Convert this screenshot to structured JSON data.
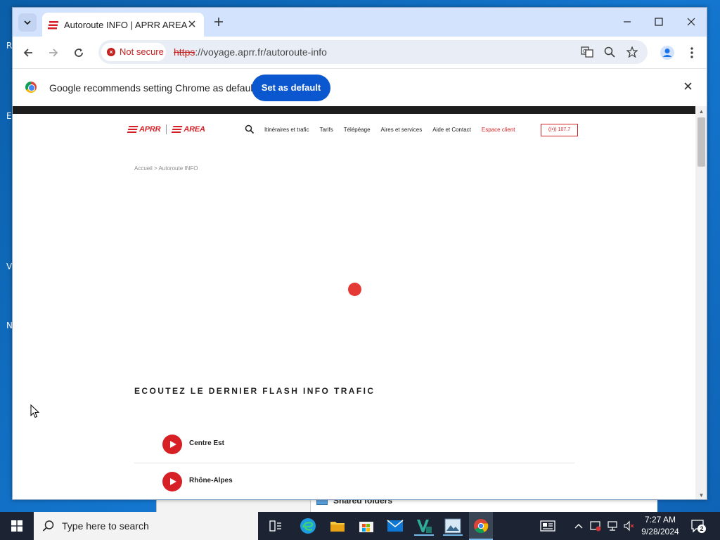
{
  "desktop": {
    "edge_letters": [
      "R",
      "E",
      "V",
      "N"
    ],
    "background_window_item": "Shared folders"
  },
  "browser": {
    "tab": {
      "title": "Autoroute INFO | APRR AREA"
    },
    "omnibox": {
      "security_label": "Not secure",
      "url_scheme": "https",
      "url_rest": "://voyage.aprr.fr/autoroute-info"
    },
    "infobar": {
      "message": "Google recommends setting Chrome as default",
      "button_label": "Set as default"
    }
  },
  "site": {
    "logo_left": "APRR",
    "logo_right": "AREA",
    "nav": [
      "Itinéraires et trafic",
      "Tarifs",
      "Télépéage",
      "Aires et services",
      "Aide et Contact"
    ],
    "account_link": "Espace client",
    "radio_label": "107.7",
    "breadcrumb": "Accueil  >  Autoroute INFO",
    "flash_title": "ECOUTEZ LE DERNIER FLASH INFO TRAFIC",
    "regions": [
      "Centre Est",
      "Rhône-Alpes"
    ],
    "accent_color": "#d71f26"
  },
  "taskbar": {
    "search_placeholder": "Type here to search",
    "time": "7:27 AM",
    "date": "9/28/2024",
    "notification_count": "2"
  }
}
